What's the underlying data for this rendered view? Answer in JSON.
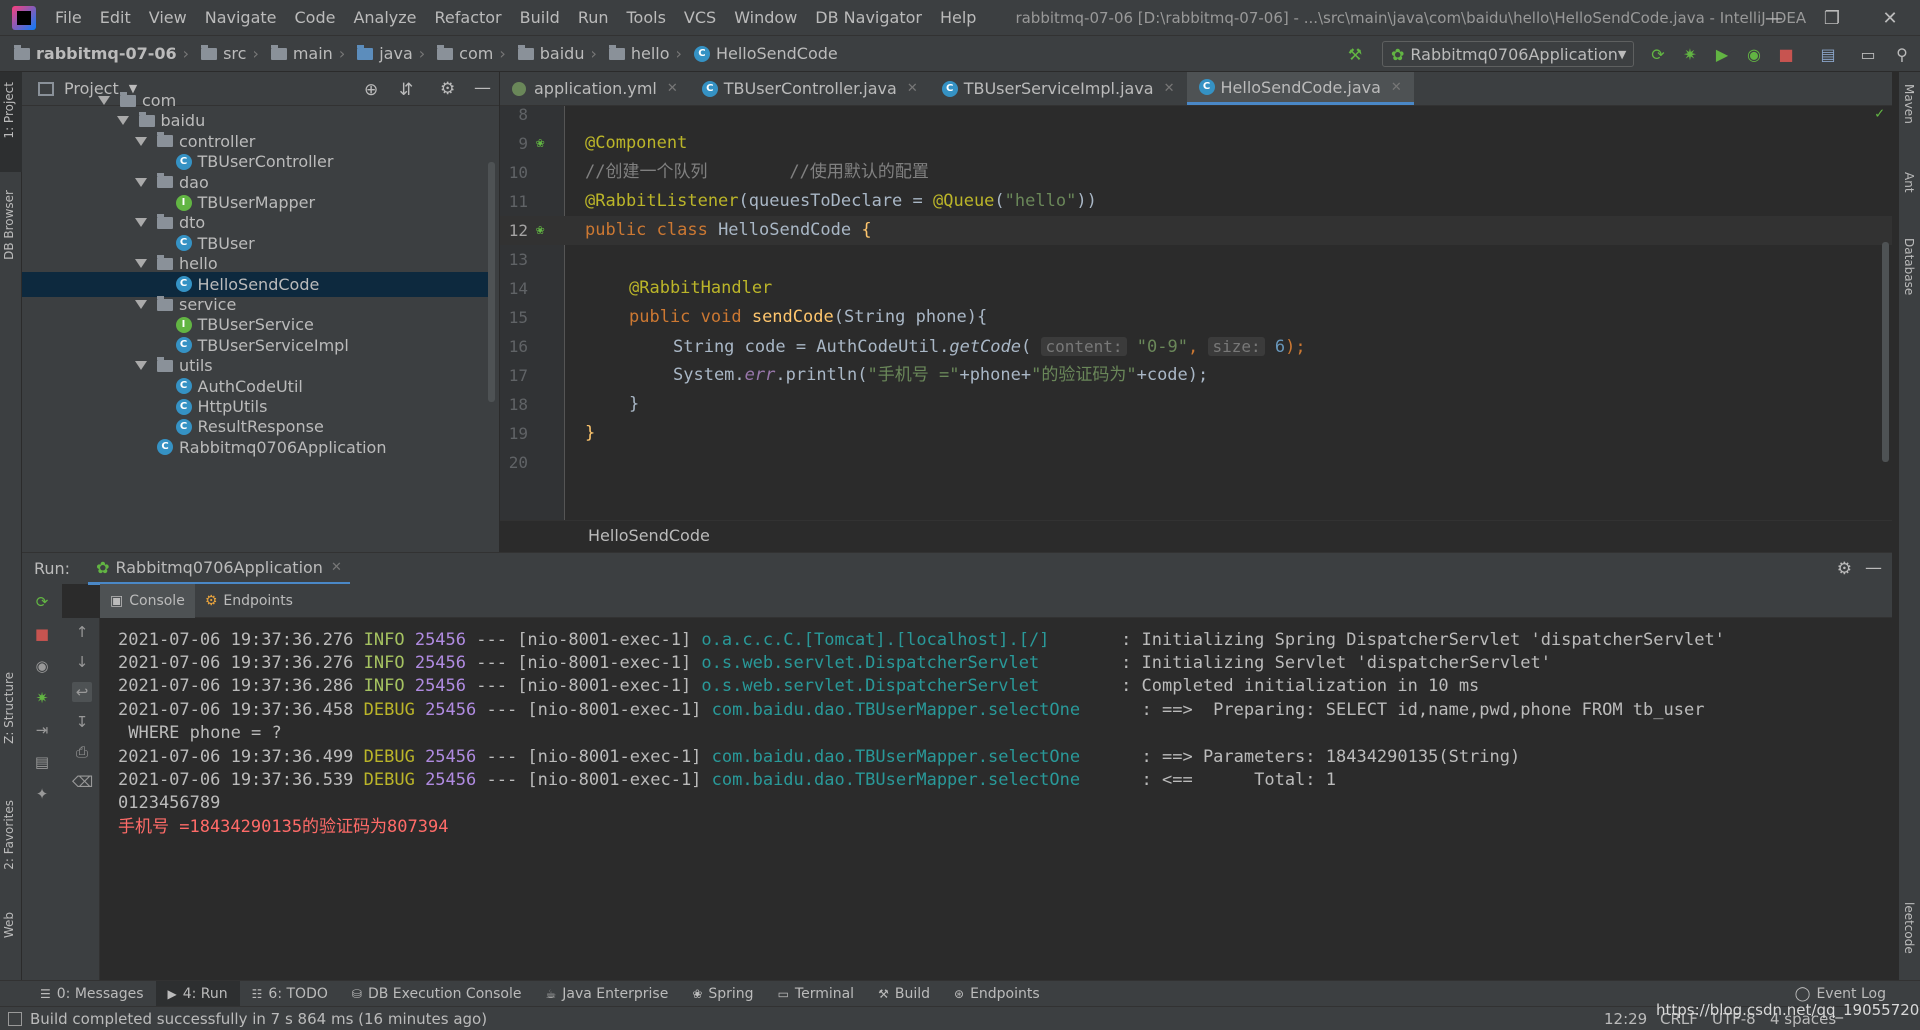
{
  "menu": {
    "items": [
      "File",
      "Edit",
      "View",
      "Navigate",
      "Code",
      "Analyze",
      "Refactor",
      "Build",
      "Run",
      "Tools",
      "VCS",
      "Window",
      "DB Navigator",
      "Help"
    ],
    "window_title": "rabbitmq-07-06 [D:\\rabbitmq-07-06] - ...\\src\\main\\java\\com\\baidu\\hello\\HelloSendCode.java - IntelliJ IDEA"
  },
  "navbar": {
    "crumbs": [
      "rabbitmq-07-06",
      "src",
      "main",
      "java",
      "com",
      "baidu",
      "hello",
      "HelloSendCode"
    ],
    "run_config": "Rabbitmq0706Application"
  },
  "left_stripe": {
    "project": "1: Project",
    "db_browser": "DB Browser",
    "structure": "Z: Structure",
    "favorites": "2: Favorites",
    "web": "Web"
  },
  "right_stripe": {
    "maven": "Maven",
    "ant": "Ant",
    "database": "Database",
    "leetcode": "leetcode"
  },
  "project": {
    "title": "Project",
    "tree": [
      {
        "label": "com",
        "type": "folder",
        "depth": 0,
        "expanded": true
      },
      {
        "label": "baidu",
        "type": "folder",
        "depth": 1,
        "expanded": true
      },
      {
        "label": "controller",
        "type": "folder",
        "depth": 2,
        "expanded": true
      },
      {
        "label": "TBUserController",
        "type": "class",
        "depth": 3
      },
      {
        "label": "dao",
        "type": "folder",
        "depth": 2,
        "expanded": true
      },
      {
        "label": "TBUserMapper",
        "type": "interface",
        "depth": 3
      },
      {
        "label": "dto",
        "type": "folder",
        "depth": 2,
        "expanded": true
      },
      {
        "label": "TBUser",
        "type": "class",
        "depth": 3
      },
      {
        "label": "hello",
        "type": "folder",
        "depth": 2,
        "expanded": true
      },
      {
        "label": "HelloSendCode",
        "type": "class",
        "depth": 3,
        "selected": true
      },
      {
        "label": "service",
        "type": "folder",
        "depth": 2,
        "expanded": true
      },
      {
        "label": "TBUserService",
        "type": "interface",
        "depth": 3
      },
      {
        "label": "TBUserServiceImpl",
        "type": "class",
        "depth": 3
      },
      {
        "label": "utils",
        "type": "folder",
        "depth": 2,
        "expanded": true
      },
      {
        "label": "AuthCodeUtil",
        "type": "class",
        "depth": 3
      },
      {
        "label": "HttpUtils",
        "type": "class",
        "depth": 3
      },
      {
        "label": "ResultResponse",
        "type": "class",
        "depth": 3
      },
      {
        "label": "Rabbitmq0706Application",
        "type": "class",
        "depth": 2
      }
    ]
  },
  "editor_tabs": [
    {
      "label": "application.yml",
      "icon": "yml-icon",
      "active": false
    },
    {
      "label": "TBUserController.java",
      "icon": "class-icon",
      "active": false
    },
    {
      "label": "TBUserServiceImpl.java",
      "icon": "class-icon",
      "active": false
    },
    {
      "label": "HelloSendCode.java",
      "icon": "class-icon",
      "active": true
    }
  ],
  "editor": {
    "line_numbers": [
      "8",
      "9",
      "10",
      "11",
      "12",
      "13",
      "14",
      "15",
      "16",
      "17",
      "18",
      "19",
      "20"
    ],
    "current_line": "12",
    "breadcrumb": "HelloSendCode",
    "code": {
      "l9_ann": "@Component",
      "l10_cmt": "//创建一个队列        //使用默认的配置",
      "l11_ann": "@RabbitListener",
      "l11_mid": "(queuesToDeclare = ",
      "l11_ann2": "@Queue",
      "l11_open": "(",
      "l11_str": "\"hello\"",
      "l11_close": "))",
      "l12_kw": "public class ",
      "l12_name": "HelloSendCode ",
      "l12_brace": "{",
      "l14_ann": "@RabbitHandler",
      "l15_kw": "public void ",
      "l15_fn": "sendCode",
      "l15_rest": "(String phone){",
      "l16_a": "String code = AuthCodeUtil.",
      "l16_fn": "getCode",
      "l16_open": "( ",
      "l16_hint1": "content:",
      "l16_str": " \"0-9\"",
      "l16_comma": ", ",
      "l16_hint2": "size:",
      "l16_num": " 6",
      "l16_end": ");",
      "l17_a": "System.",
      "l17_err": "err",
      "l17_b": ".println(",
      "l17_s1": "\"手机号 =\"",
      "l17_c": "+phone+",
      "l17_s2": "\"的验证码为\"",
      "l17_d": "+code);",
      "l18": "}",
      "l19": "}"
    }
  },
  "run": {
    "label": "Run:",
    "config": "Rabbitmq0706Application",
    "subtabs": [
      "Console",
      "Endpoints"
    ],
    "log": [
      {
        "ts": "2021-07-06 19:37:36.276",
        "level": " INFO",
        "pid": " 25456",
        "thread": " --- [nio-8001-exec-1] ",
        "logger": "o.a.c.c.C.[Tomcat].[localhost].[/]      ",
        "msg": " : Initializing Spring DispatcherServlet 'dispatcherServlet'"
      },
      {
        "ts": "2021-07-06 19:37:36.276",
        "level": " INFO",
        "pid": " 25456",
        "thread": " --- [nio-8001-exec-1] ",
        "logger": "o.s.web.servlet.DispatcherServlet       ",
        "msg": " : Initializing Servlet 'dispatcherServlet'"
      },
      {
        "ts": "2021-07-06 19:37:36.286",
        "level": " INFO",
        "pid": " 25456",
        "thread": " --- [nio-8001-exec-1] ",
        "logger": "o.s.web.servlet.DispatcherServlet       ",
        "msg": " : Completed initialization in 10 ms"
      },
      {
        "ts": "2021-07-06 19:37:36.458",
        "level": " DEBUG",
        "pid": " 25456",
        "thread": " --- [nio-8001-exec-1] ",
        "logger": "com.baidu.dao.TBUserMapper.selectOne     ",
        "msg": " : ==>  Preparing: SELECT id,name,pwd,phone FROM tb_user"
      },
      {
        "ts": "2021-07-06 19:37:36.499",
        "level": " DEBUG",
        "pid": " 25456",
        "thread": " --- [nio-8001-exec-1] ",
        "logger": "com.baidu.dao.TBUserMapper.selectOne     ",
        "msg": " : ==> Parameters: 18434290135(String)"
      },
      {
        "ts": "2021-07-06 19:37:36.539",
        "level": " DEBUG",
        "pid": " 25456",
        "thread": " --- [nio-8001-exec-1] ",
        "logger": "com.baidu.dao.TBUserMapper.selectOne     ",
        "msg": " : <==      Total: 1"
      }
    ],
    "wrap_line": " WHERE phone = ?",
    "plain_line": "0123456789",
    "err_line": "手机号 =18434290135的验证码为807394"
  },
  "bottom_tools": [
    {
      "label": "0: Messages",
      "icon": "messages-icon",
      "active": false
    },
    {
      "label": "4: Run",
      "icon": "run-icon",
      "active": true
    },
    {
      "label": "6: TODO",
      "icon": "todo-icon",
      "active": false
    },
    {
      "label": "DB Execution Console",
      "icon": "db-console-icon",
      "active": false
    },
    {
      "label": "Java Enterprise",
      "icon": "java-enterprise-icon",
      "active": false
    },
    {
      "label": "Spring",
      "icon": "spring-icon",
      "active": false
    },
    {
      "label": "Terminal",
      "icon": "terminal-icon",
      "active": false
    },
    {
      "label": "Build",
      "icon": "build-icon",
      "active": false
    },
    {
      "label": "Endpoints",
      "icon": "endpoints-icon",
      "active": false
    }
  ],
  "event_log": "Event Log",
  "status": {
    "message": "Build completed successfully in 7 s 864 ms (16 minutes ago)",
    "caret": "12:29",
    "line_sep": "CRLF",
    "encoding": "UTF-8",
    "indent": "4 spaces",
    "watermark": "https://blog.csdn.net/qq_19055720"
  }
}
